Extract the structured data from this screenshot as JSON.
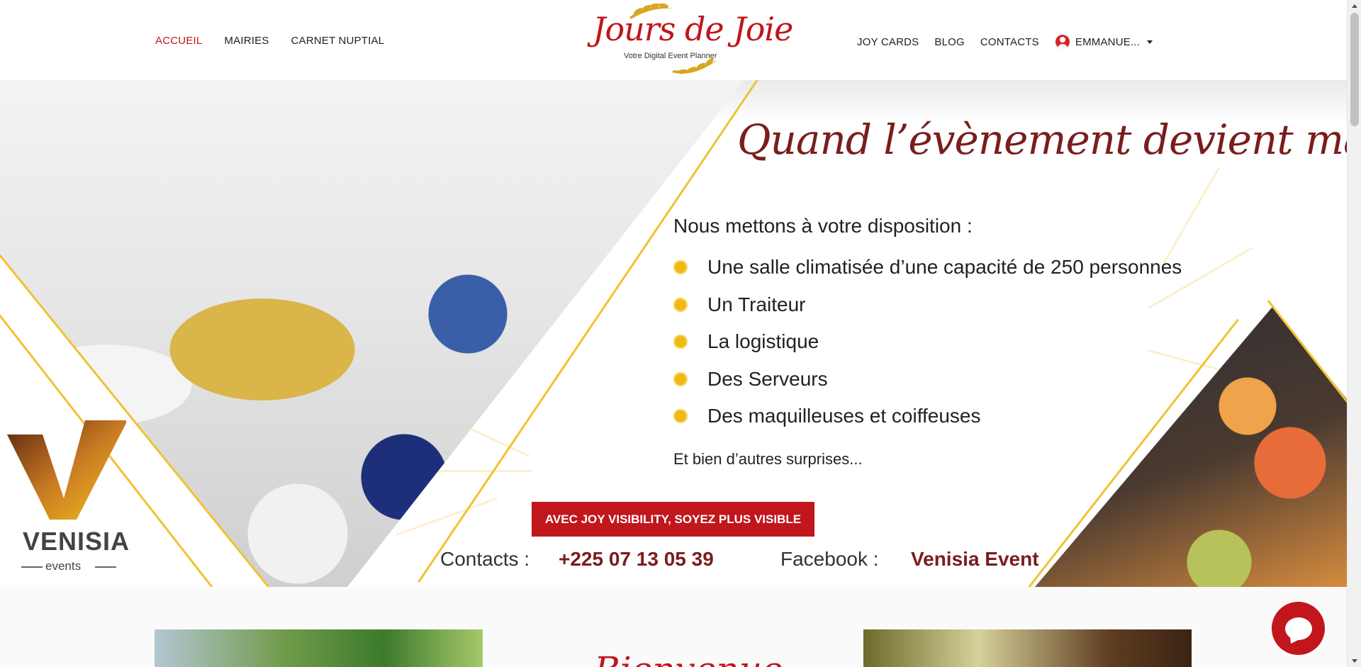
{
  "nav": {
    "left": [
      {
        "label": "ACCUEIL",
        "active": true
      },
      {
        "label": "MAIRIES",
        "active": false
      },
      {
        "label": "CARNET NUPTIAL",
        "active": false
      }
    ],
    "right": [
      {
        "label": "JOY CARDS"
      },
      {
        "label": "BLOG"
      },
      {
        "label": "CONTACTS"
      }
    ],
    "user": {
      "label": "EMMANUE...",
      "icon": "user-circle-icon"
    }
  },
  "logo": {
    "name": "Jours de Joie",
    "tagline": "Votre Digital Event Planner"
  },
  "banner": {
    "headline": "Quand l’évènement devient magie !",
    "intro": "Nous mettons à votre disposition :",
    "services": [
      "Une salle climatisée d’une capacité de 250 personnes",
      "Un Traiteur",
      "La logistique",
      "Des Serveurs",
      "Des maquilleuses et coiffeuses"
    ],
    "outro": "Et bien d’autres surprises...",
    "cta": "AVEC JOY VISIBILITY, SOYEZ PLUS VISIBLE",
    "contacts_label": "Contacts :",
    "contacts_value": "+225 07 13 05 39",
    "facebook_label": "Facebook :",
    "facebook_value": "Venisia Event",
    "brand": {
      "name": "VENISIA",
      "sub": "events"
    }
  },
  "below": {
    "welcome": "Bienvenue"
  },
  "colors": {
    "accent": "#c0161c",
    "gold": "#f1c232",
    "dark_red": "#7a1d1d"
  },
  "chat": {
    "icon": "chat-bubble-icon"
  }
}
